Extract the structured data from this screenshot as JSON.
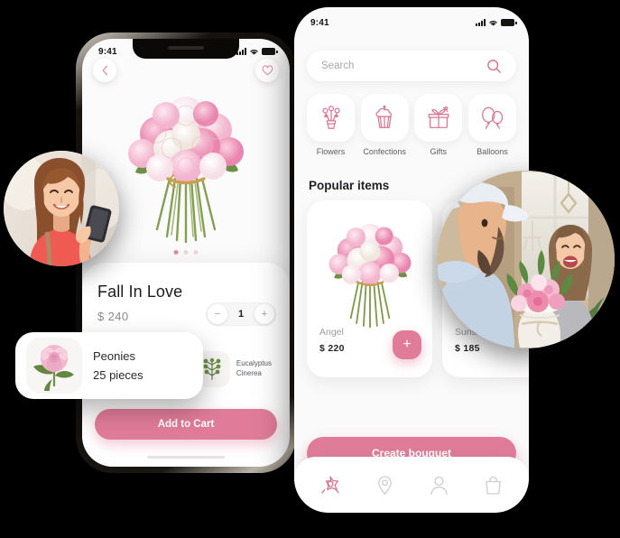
{
  "meta": {
    "accent_pink": "#e07c9a",
    "screen_bg": "#fafafa",
    "page_bg": "#000000"
  },
  "left_phone": {
    "status_bar": {
      "time": "9:41",
      "signal_icon": "cellular-bars-icon",
      "wifi_icon": "wifi-icon",
      "battery_icon": "battery-icon"
    },
    "back_button_icon": "chevron-left-icon",
    "favorite_button_icon": "heart-outline-icon",
    "hero_image_alt": "pink and white peony bouquet",
    "carousel": {
      "total": 3,
      "active_index": 0
    },
    "product": {
      "title": "Fall In Love",
      "price": "$ 240",
      "quantity": "1",
      "decrement_label": "−",
      "increment_label": "+"
    },
    "ingredients": [
      {
        "name": "Peonies",
        "detail": "25 pieces",
        "thumb_icon": "peony-flower-icon"
      },
      {
        "name": "Eucalyptus",
        "detail": "Cinerea",
        "thumb_icon": "eucalyptus-sprig-icon"
      }
    ],
    "cta_label": "Add to Cart"
  },
  "right_phone": {
    "status_bar": {
      "time": "9:41",
      "signal_icon": "cellular-bars-icon",
      "wifi_icon": "wifi-icon",
      "battery_icon": "battery-icon"
    },
    "search": {
      "placeholder": "Search",
      "value": "",
      "icon": "search-icon"
    },
    "categories": [
      {
        "label": "Flowers",
        "icon": "bouquet-icon"
      },
      {
        "label": "Confections",
        "icon": "cupcake-icon"
      },
      {
        "label": "Gifts",
        "icon": "gift-box-icon"
      },
      {
        "label": "Balloons",
        "icon": "balloons-icon"
      }
    ],
    "section_title": "Popular items",
    "popular_items": [
      {
        "name": "Angel",
        "price": "$ 220",
        "add_label": "+",
        "image_alt": "pink peony bouquet"
      },
      {
        "name": "Sunshine Fore",
        "price": "$ 185",
        "add_label": "+",
        "image_alt": "flower box arrangement"
      }
    ],
    "cta_label": "Create bouquet",
    "tabs": [
      {
        "name": "home",
        "icon": "flower-icon",
        "active": true
      },
      {
        "name": "locations",
        "icon": "map-pin-icon",
        "active": false
      },
      {
        "name": "profile",
        "icon": "person-icon",
        "active": false
      },
      {
        "name": "cart",
        "icon": "shopping-bag-icon",
        "active": false
      }
    ]
  },
  "bubbles": [
    {
      "name": "woman-with-phone",
      "alt": "smiling woman in red top looking at smartphone"
    },
    {
      "name": "flower-delivery",
      "alt": "delivery man in cap handing a flower box to a smiling woman"
    }
  ],
  "floating_card": {
    "name": "Peonies",
    "quantity": "25 pieces",
    "thumb_icon": "peony-flower-icon"
  }
}
